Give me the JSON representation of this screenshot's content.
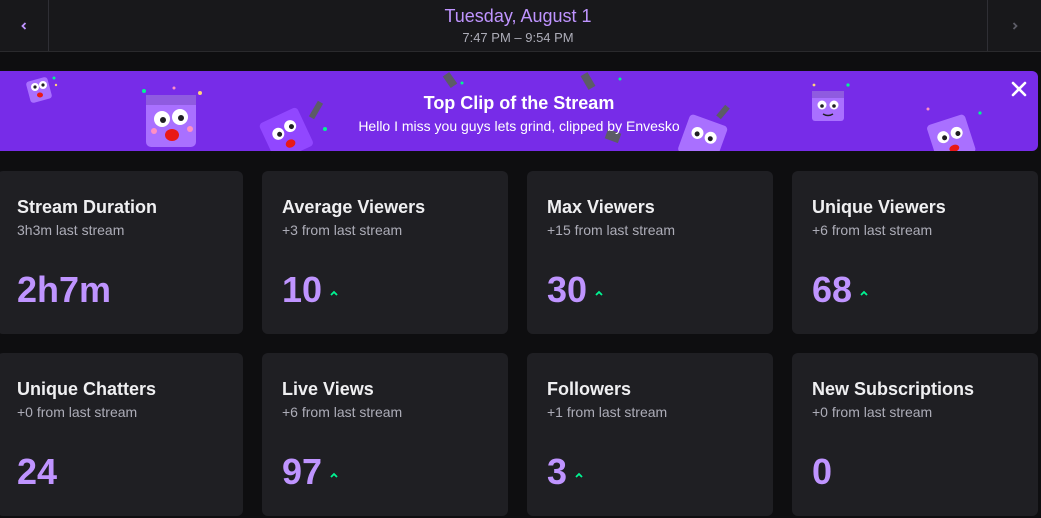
{
  "header": {
    "prev_icon": "chevron-left-icon",
    "next_icon": "chevron-right-icon",
    "date": "Tuesday, August 1",
    "time_range": "7:47 PM – 9:54 PM"
  },
  "banner": {
    "title": "Top Clip of the Stream",
    "subtitle": "Hello I miss you guys lets grind, clipped by Envesko",
    "close_icon": "close-icon",
    "background": "#772ce8"
  },
  "colors": {
    "accent": "#bf94ff",
    "trend_up": "#00f593",
    "card_bg": "#1f1f23"
  },
  "stats": [
    {
      "title": "Stream Duration",
      "sub": "3h3m last stream",
      "value": "2h7m",
      "trend": ""
    },
    {
      "title": "Average Viewers",
      "sub": "+3 from last stream",
      "value": "10",
      "trend": "up"
    },
    {
      "title": "Max Viewers",
      "sub": "+15 from last stream",
      "value": "30",
      "trend": "up"
    },
    {
      "title": "Unique Viewers",
      "sub": "+6 from last stream",
      "value": "68",
      "trend": "up"
    },
    {
      "title": "Unique Chatters",
      "sub": "+0 from last stream",
      "value": "24",
      "trend": ""
    },
    {
      "title": "Live Views",
      "sub": "+6 from last stream",
      "value": "97",
      "trend": "up"
    },
    {
      "title": "Followers",
      "sub": "+1 from last stream",
      "value": "3",
      "trend": "up"
    },
    {
      "title": "New Subscriptions",
      "sub": "+0 from last stream",
      "value": "0",
      "trend": ""
    }
  ]
}
